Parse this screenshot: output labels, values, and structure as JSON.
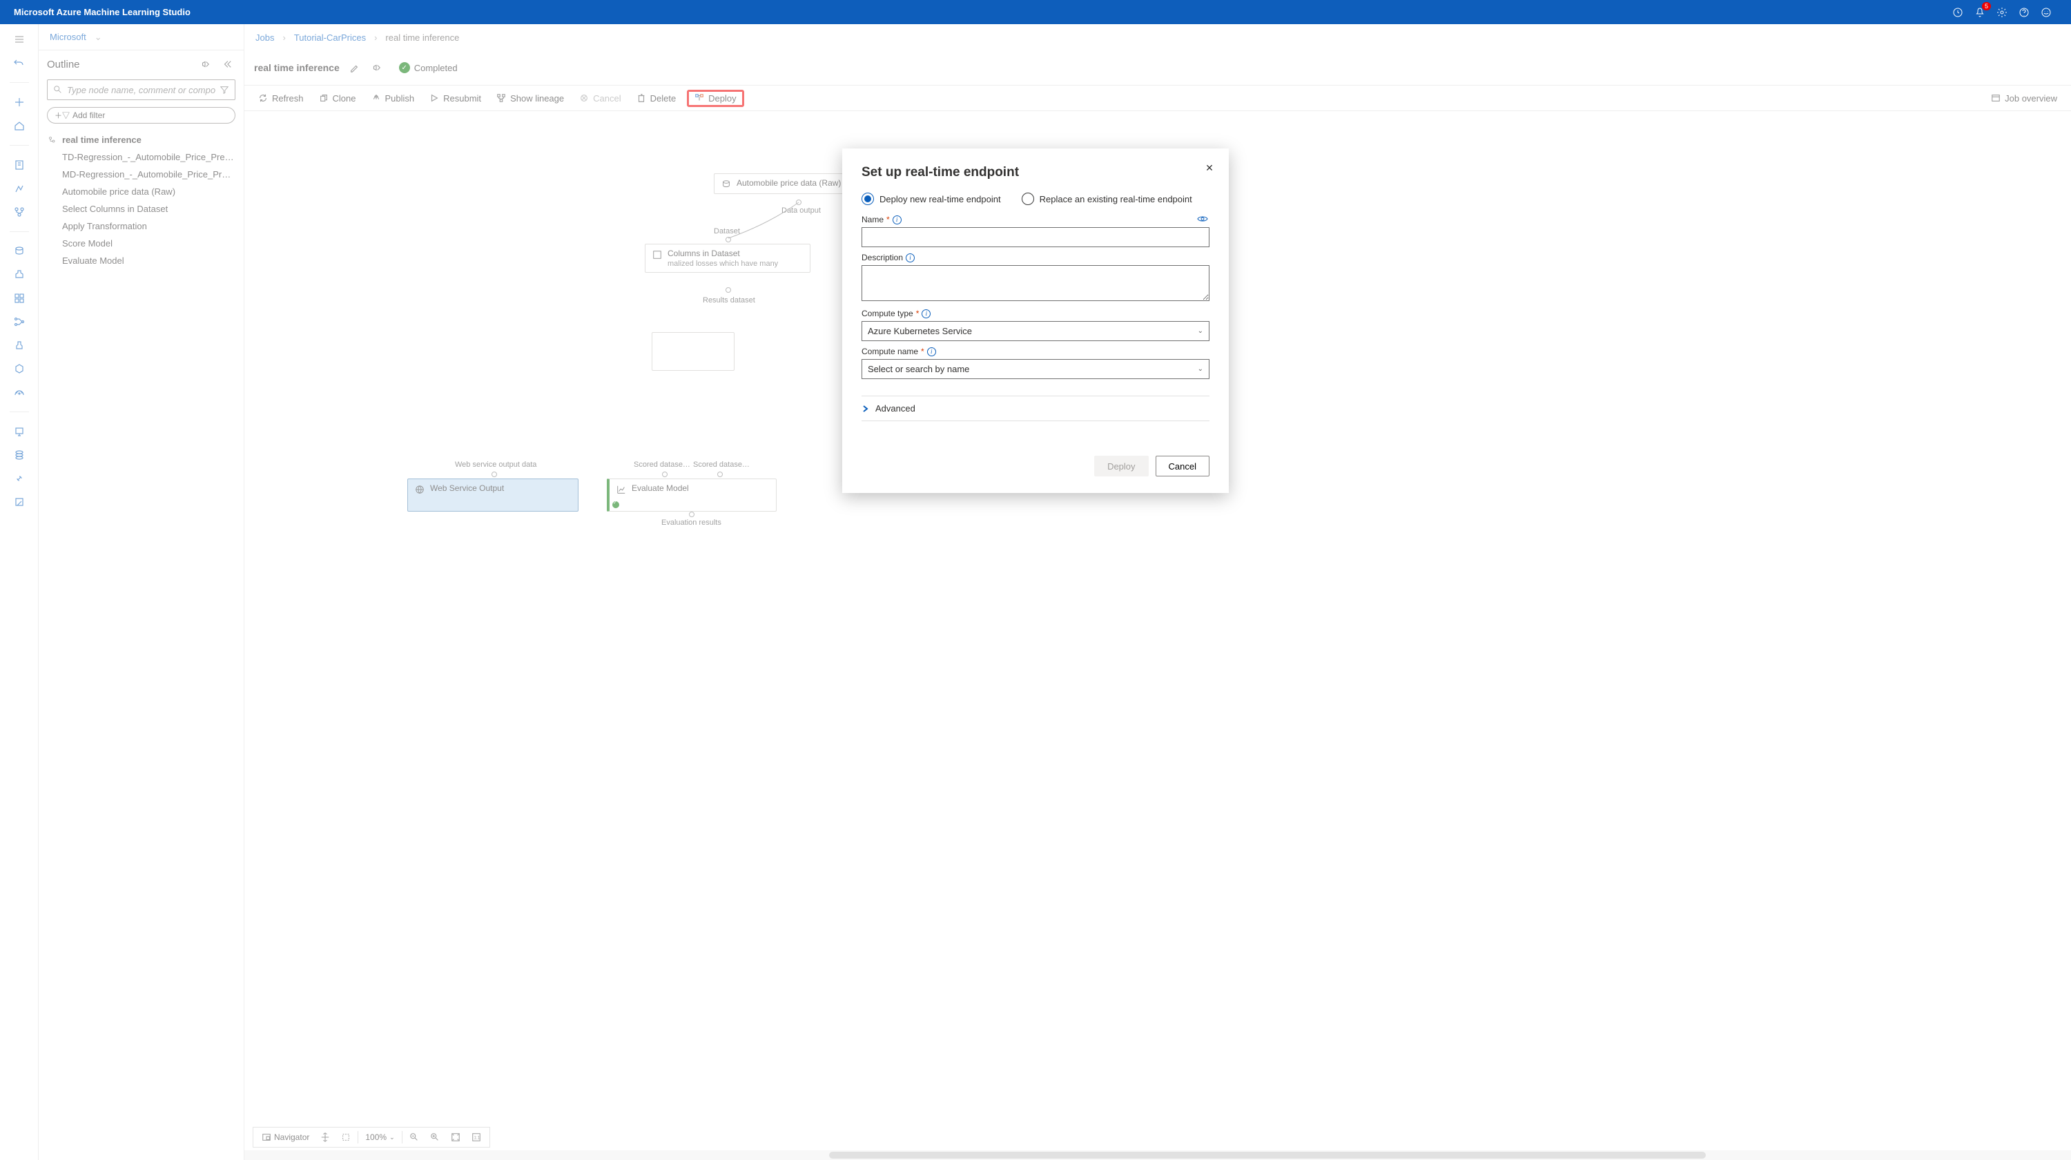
{
  "app_title": "Microsoft Azure Machine Learning Studio",
  "topbar": {
    "notif_count": "5"
  },
  "breadcrumbs": {
    "ws": "Microsoft",
    "jobs": "Jobs",
    "exp": "Tutorial-CarPrices",
    "job": "real time inference"
  },
  "outline": {
    "title": "Outline",
    "search_placeholder": "Type node name, comment or compon",
    "add_filter": "Add filter",
    "root": "real time inference",
    "items": [
      "TD-Regression_-_Automobile_Price_Predict…",
      "MD-Regression_-_Automobile_Price_Predic…",
      "Automobile price data (Raw)",
      "Select Columns in Dataset",
      "Apply Transformation",
      "Score Model",
      "Evaluate Model"
    ]
  },
  "header": {
    "job_title": "real time inference",
    "status": "Completed",
    "job_overview": "Job overview"
  },
  "toolbar": {
    "refresh": "Refresh",
    "clone": "Clone",
    "publish": "Publish",
    "resubmit": "Resubmit",
    "lineage": "Show lineage",
    "cancel": "Cancel",
    "delete": "Delete",
    "deploy": "Deploy"
  },
  "nodes": {
    "raw": "Automobile price data (Raw)",
    "raw_out": "Data output",
    "dataset": "Dataset",
    "sel": "Columns in Dataset",
    "sel_sub": "malized losses which have many",
    "sel_out": "Results dataset",
    "wso_in": "Web service output data",
    "wso": "Web Service Output",
    "eval_in_l": "Scored datase…",
    "eval_in_r": "Scored datase…",
    "eval": "Evaluate Model",
    "eval_out": "Evaluation results"
  },
  "bottombar": {
    "navigator": "Navigator",
    "zoom": "100%"
  },
  "modal": {
    "title": "Set up real-time endpoint",
    "r1": "Deploy new real-time endpoint",
    "r2": "Replace an existing real-time endpoint",
    "name_lbl": "Name",
    "desc_lbl": "Description",
    "ctype_lbl": "Compute type",
    "ctype_val": "Azure Kubernetes Service",
    "cname_lbl": "Compute name",
    "cname_val": "Select or search by name",
    "adv": "Advanced",
    "deploy": "Deploy",
    "cancel": "Cancel"
  }
}
